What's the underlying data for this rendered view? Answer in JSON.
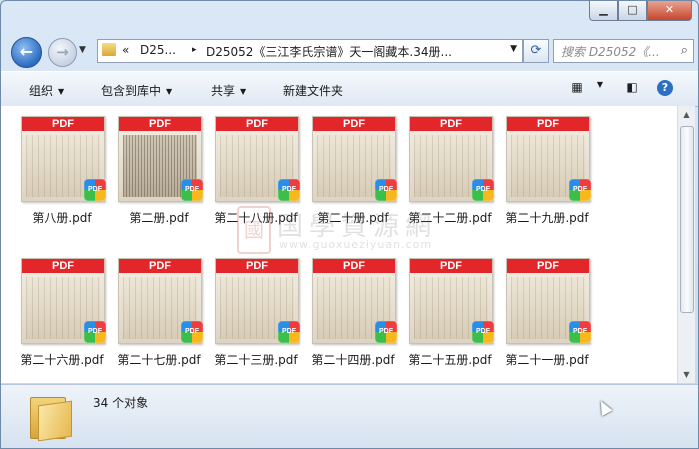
{
  "window": {
    "controls": {
      "minimize": "▁",
      "maximize": "□",
      "close": "✕"
    }
  },
  "nav": {
    "back_icon": "arrow-left-icon",
    "forward_icon": "arrow-right-icon",
    "address": {
      "prefix": "«",
      "crumb1": "D25...",
      "sep": "▸",
      "crumb2": "D25052《三江李氏宗谱》天一阁藏本.34册..."
    },
    "search_placeholder": "搜索 D25052《..."
  },
  "toolbar": {
    "organize": "组织",
    "include_in_library": "包含到库中",
    "share": "共享",
    "new_folder": "新建文件夹"
  },
  "files": [
    {
      "name": "第八册.pdf",
      "dark": false
    },
    {
      "name": "第二册.pdf",
      "dark": true
    },
    {
      "name": "第二十八册.pdf",
      "dark": false
    },
    {
      "name": "第二十册.pdf",
      "dark": false
    },
    {
      "name": "第二十二册.pdf",
      "dark": false
    },
    {
      "name": "第二十九册.pdf",
      "dark": false
    },
    {
      "name": "第二十六册.pdf",
      "dark": false
    },
    {
      "name": "第二十七册.pdf",
      "dark": false
    },
    {
      "name": "第二十三册.pdf",
      "dark": false
    },
    {
      "name": "第二十四册.pdf",
      "dark": false
    },
    {
      "name": "第二十五册.pdf",
      "dark": false
    },
    {
      "name": "第二十一册.pdf",
      "dark": false
    }
  ],
  "thumb_label": "PDF",
  "watermark": {
    "seal": "國",
    "text": "国學資源網",
    "url": "www.guoxueziyuan.com"
  },
  "status": {
    "count": "34 个对象"
  }
}
